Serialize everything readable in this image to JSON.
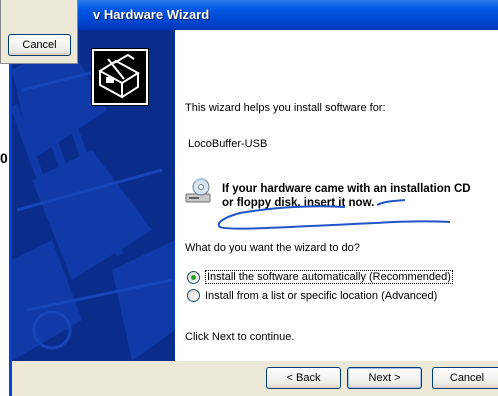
{
  "background_window": {
    "cancel_label": "Cancel",
    "partial_text": "0"
  },
  "wizard": {
    "title": "v Hardware Wizard",
    "icon": "hardware-install-icon",
    "intro_text": "This wizard helps you install software for:",
    "device_name": "LocoBuffer-USB",
    "cd_icon": "cd-drive-icon",
    "cd_hint_line1": "If your hardware came with an installation CD",
    "cd_hint_line2": "or floppy disk, insert it now.",
    "question": "What do you want the wizard to do?",
    "options": [
      {
        "label": "Install the software automatically (Recommended)",
        "selected": true
      },
      {
        "label": "Install from a list or specific location (Advanced)",
        "selected": false
      }
    ],
    "continue_text": "Click Next to continue.",
    "buttons": {
      "back": "< Back",
      "next": "Next >",
      "cancel": "Cancel"
    },
    "colors": {
      "titlebar": "#0058e6",
      "banner": "#0a2d8c",
      "annotation": "#1f55c8"
    }
  }
}
